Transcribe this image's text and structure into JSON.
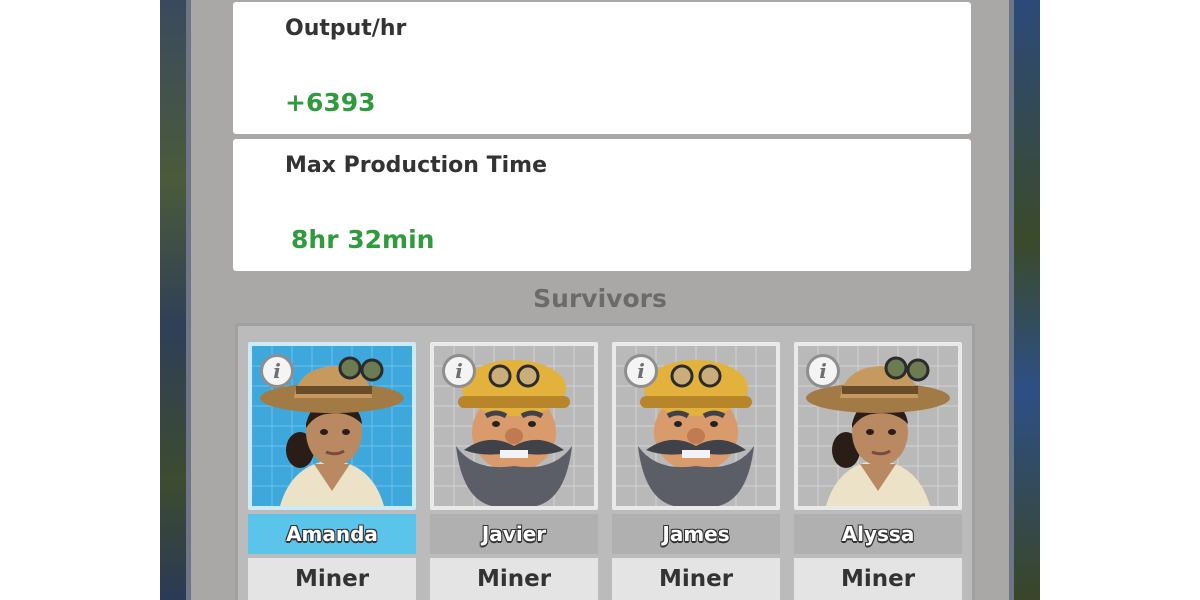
{
  "stats": {
    "output_label": "Output/hr",
    "output_value": "+6393",
    "max_time_label": "Max Production Time",
    "max_time_value": "8hr 32min"
  },
  "survivors_title": "Survivors",
  "survivors": [
    {
      "name": "Amanda",
      "role": "Miner",
      "portrait": "explorer-woman",
      "selected": true
    },
    {
      "name": "Javier",
      "role": "Miner",
      "portrait": "bearded-miner",
      "selected": false
    },
    {
      "name": "James",
      "role": "Miner",
      "portrait": "bearded-miner",
      "selected": false
    },
    {
      "name": "Alyssa",
      "role": "Miner",
      "portrait": "explorer-woman",
      "selected": false
    }
  ],
  "info_glyph": "i",
  "colors": {
    "value_green": "#2f9b3c",
    "selected_blue": "#5bc4ea",
    "panel_gray": "#a9a8a6"
  }
}
